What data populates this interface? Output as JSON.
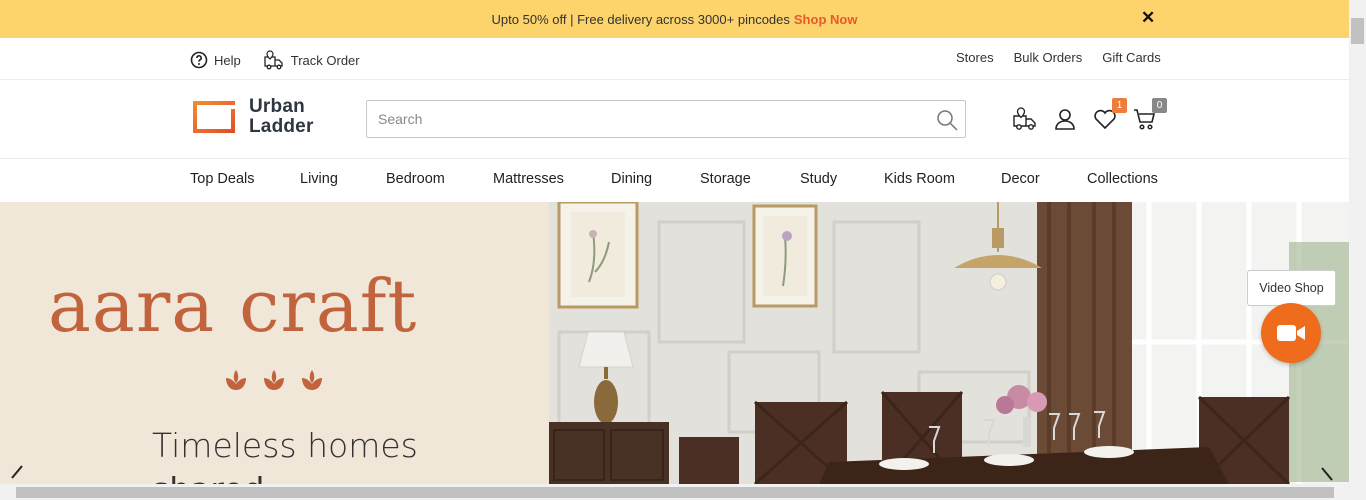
{
  "promo": {
    "text": "Upto 50% off | Free delivery across 3000+ pincodes",
    "cta": "Shop Now",
    "close_icon": "close-icon",
    "bg_color": "#fdd36b",
    "cta_color": "#e9592b"
  },
  "util_bar": {
    "left": [
      {
        "label": "Help",
        "icon": "help-circle-icon"
      },
      {
        "label": "Track Order",
        "icon": "delivery-truck-icon"
      }
    ],
    "right": [
      "Stores",
      "Bulk Orders",
      "Gift Cards"
    ]
  },
  "header": {
    "logo_line1": "Urban",
    "logo_line2": "Ladder",
    "search_placeholder": "Search",
    "wishlist_count": "1",
    "cart_count": "0",
    "accent_color": "#ef7c3b"
  },
  "nav": [
    "Top Deals",
    "Living",
    "Bedroom",
    "Mattresses",
    "Dining",
    "Storage",
    "Study",
    "Kids Room",
    "Decor",
    "Collections"
  ],
  "hero": {
    "title": "aara craft",
    "subtitle": "Timeless homes",
    "subtitle2": "shared"
  },
  "video_shop": {
    "label": "Video Shop",
    "icon": "video-camera-icon",
    "color": "#ef6c1d"
  }
}
